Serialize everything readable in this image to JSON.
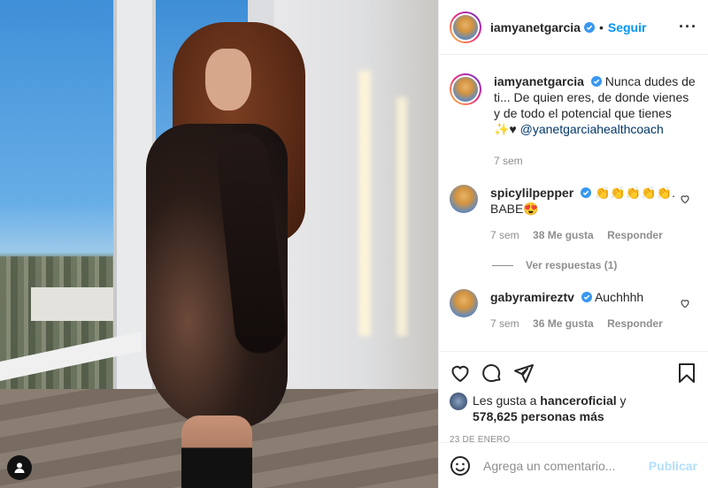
{
  "post": {
    "username": "iamyanetgarcia",
    "follow_label": "Seguir",
    "caption_user": "iamyanetgarcia",
    "caption_text": "Nunca dudes de ti... De quien eres, de donde vienes y de todo el potencial que tienes ✨♥",
    "caption_mention": "@yanetgarciahealthcoach",
    "caption_age": "7 sem"
  },
  "comments": [
    {
      "user": "spicylilpepper",
      "text": "👏👏👏👏👏. BABE😍",
      "age": "7 sem",
      "likes": "38 Me gusta",
      "reply_label": "Responder",
      "view_replies": "Ver respuestas (1)"
    },
    {
      "user": "gabyramireztv",
      "text": "Auchhhh",
      "age": "7 sem",
      "likes": "36 Me gusta",
      "reply_label": "Responder"
    }
  ],
  "likes_block": {
    "prefix": "Les gusta a",
    "liker": "hanceroficial",
    "joiner": "y",
    "others": "578,625 personas más"
  },
  "date": "23 DE ENERO",
  "add_comment": {
    "placeholder": "Agrega un comentario...",
    "post_label": "Publicar"
  },
  "colors": {
    "accent": "#0095f6",
    "mention": "#00376b",
    "muted": "#8e8e8e",
    "post_disabled": "#b2dffc"
  },
  "icons": [
    "verified-icon",
    "more-icon",
    "heart-icon",
    "comment-icon",
    "share-icon",
    "bookmark-icon",
    "emoji-icon",
    "user-icon"
  ]
}
